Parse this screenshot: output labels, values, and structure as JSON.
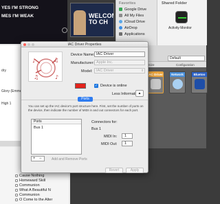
{
  "background": {
    "lyrics": {
      "line1": "YES I'M STRONG",
      "line2": "MES I'M WEAK"
    },
    "left_list": [
      "dry",
      "Glory (Emme",
      "High 1"
    ],
    "welcome_text": "WELCOME TO CH",
    "finder": {
      "sidebar_header": "Favorites",
      "favorites": [
        {
          "label": "Google Drive",
          "color": "#3aa757"
        },
        {
          "label": "All My Files",
          "color": "#8c8c8c"
        },
        {
          "label": "iCloud Drive",
          "color": "#5aa7e8"
        },
        {
          "label": "AirDrop",
          "color": "#3a8ee6"
        },
        {
          "label": "Applications",
          "color": "#6f6f6f"
        }
      ],
      "shared_header": "Shared Folder",
      "activity_label": "Activity Monitor"
    },
    "midi_studio": {
      "default_label": "Default",
      "icon_size_label": "Icon Size",
      "configuration_label": "Configuration",
      "devices": [
        {
          "label": "IAC Driver",
          "color": "#e8a23a"
        },
        {
          "label": "Network",
          "color": "#4a8fd9"
        },
        {
          "label": "Bluetoo",
          "color": "#2e63c7"
        }
      ]
    },
    "songs": [
      "Cause Nothing",
      "Homeward Skill",
      "Communion",
      "What A Beautiful N",
      "Communion",
      "O Come to the Alter"
    ]
  },
  "dialog": {
    "title": "IAC Driver Properties",
    "device_name_label": "Device Name:",
    "device_name_value": "IAC Driver",
    "manufacturer_label": "Manufacturer:",
    "manufacturer_value": "Apple Inc.",
    "model_label": "Model:",
    "model_value": "IAC Driver",
    "device_color": "#e4231b",
    "device_online_label": "Device is online",
    "device_online_checked": true,
    "less_info_label": "Less Information",
    "tab_label": "Ports",
    "description": "You can set up the IAC device's port structure here. First, set the number of ports on the device, then indicate the number of MIDI in and out connectors for each port.",
    "ports_header": "Ports",
    "ports": [
      "Bus 1"
    ],
    "add_remove_label": "Add and Remove Ports",
    "connectors_label": "Connectors for:",
    "connectors_for": "Bus 1",
    "midi_in_label": "MIDI In:",
    "midi_in_value": "1",
    "midi_out_label": "MIDI Out:",
    "midi_out_value": "1",
    "revert_label": "Revert",
    "apply_label": "Apply"
  }
}
